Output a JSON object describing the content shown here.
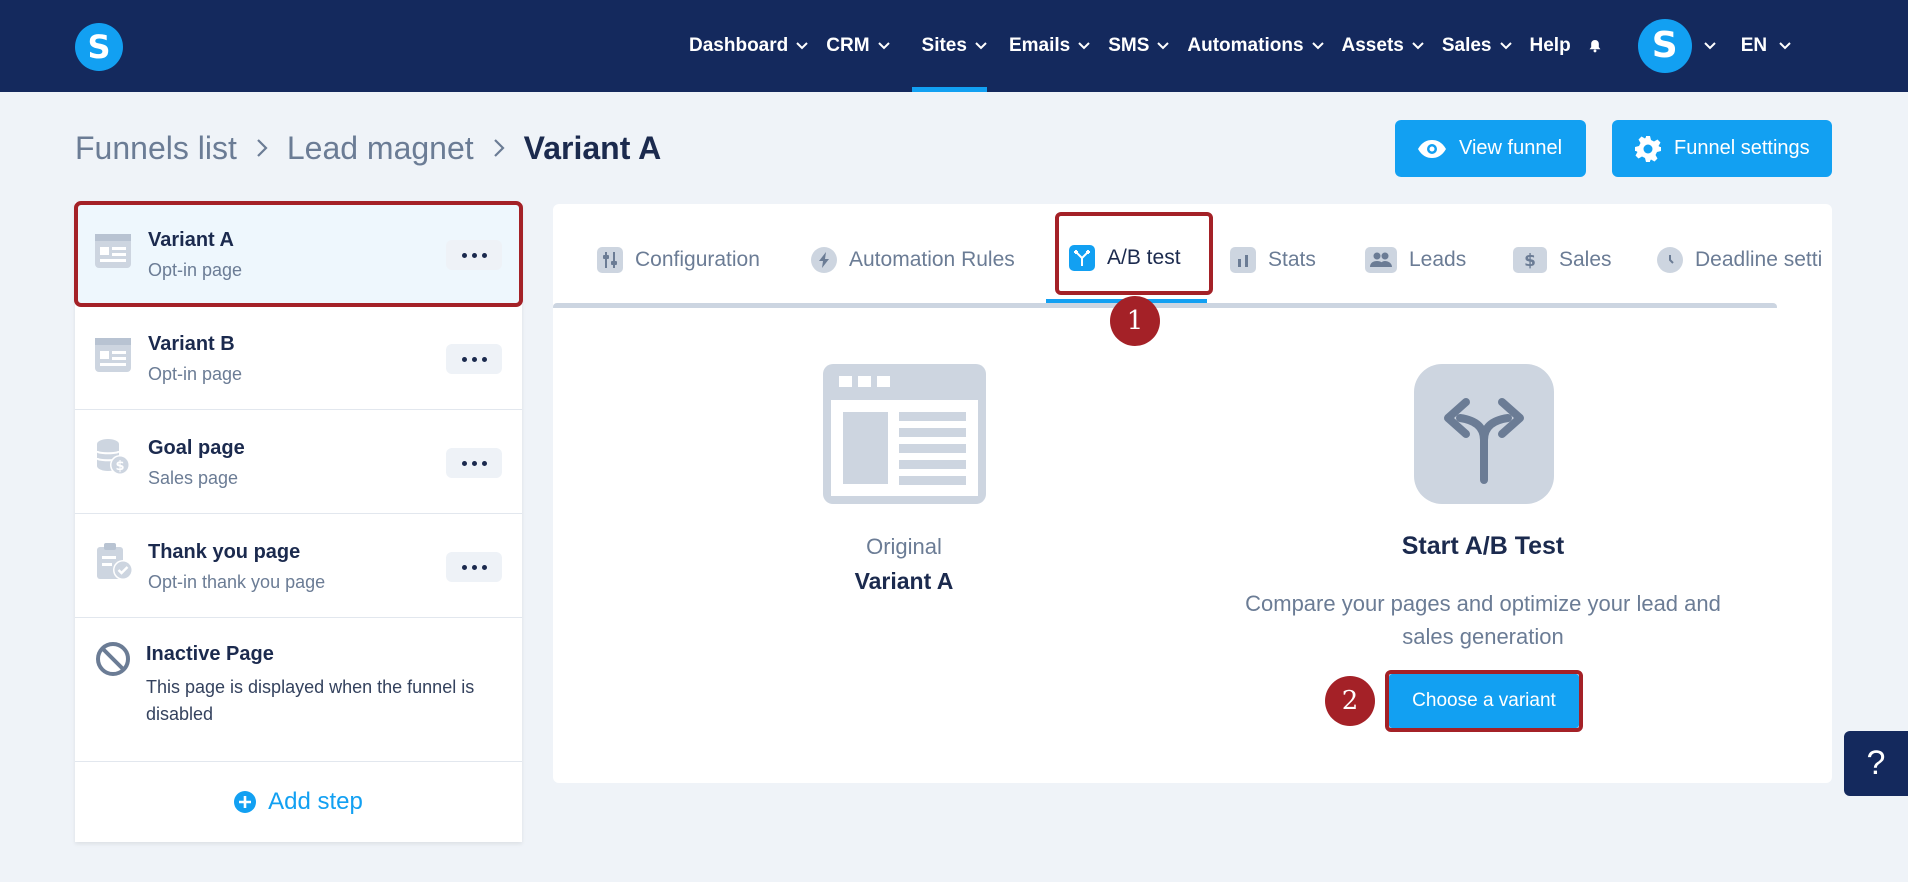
{
  "nav": {
    "items": [
      {
        "label": "Dashboard",
        "has_menu": true
      },
      {
        "label": "CRM",
        "has_menu": true
      },
      {
        "label": "Sites",
        "has_menu": true,
        "active": true
      },
      {
        "label": "Emails",
        "has_menu": true
      },
      {
        "label": "SMS",
        "has_menu": true
      },
      {
        "label": "Automations",
        "has_menu": true
      },
      {
        "label": "Assets",
        "has_menu": true
      },
      {
        "label": "Sales",
        "has_menu": true
      },
      {
        "label": "Help",
        "has_menu": false
      }
    ],
    "logo_letter": "S",
    "avatar_letter": "S",
    "language": "EN"
  },
  "breadcrumb": [
    "Funnels list",
    "Lead magnet",
    "Variant A"
  ],
  "header_buttons": {
    "view_funnel": "View funnel",
    "funnel_settings": "Funnel settings"
  },
  "steps": [
    {
      "title": "Variant A",
      "subtitle": "Opt-in page",
      "icon": "page-icon",
      "selected": true
    },
    {
      "title": "Variant B",
      "subtitle": "Opt-in page",
      "icon": "page-icon"
    },
    {
      "title": "Goal page",
      "subtitle": "Sales page",
      "icon": "coins-icon"
    },
    {
      "title": "Thank you page",
      "subtitle": "Opt-in thank you page",
      "icon": "clipboard-check-icon"
    }
  ],
  "inactive_page": {
    "title": "Inactive Page",
    "description": "This page is displayed when the funnel is disabled"
  },
  "add_step_label": "Add step",
  "tabs": [
    {
      "label": "Configuration",
      "icon": "sliders-icon"
    },
    {
      "label": "Automation Rules",
      "icon": "bolt-icon"
    },
    {
      "label": "A/B test",
      "icon": "split-icon",
      "active": true
    },
    {
      "label": "Stats",
      "icon": "bar-chart-icon"
    },
    {
      "label": "Leads",
      "icon": "users-icon"
    },
    {
      "label": "Sales",
      "icon": "dollar-icon"
    },
    {
      "label": "Deadline setti",
      "icon": "clock-icon"
    }
  ],
  "ab_test": {
    "original_label": "Original",
    "original_name": "Variant A",
    "title": "Start A/B Test",
    "description": "Compare your pages and optimize your lead and sales generation",
    "choose_button": "Choose a variant"
  },
  "markers": [
    "1",
    "2"
  ],
  "help_button": "?",
  "colors": {
    "nav_bg": "#14295d",
    "accent": "#12a0f2",
    "highlight": "#a42127",
    "page_bg": "#eff3f8"
  }
}
